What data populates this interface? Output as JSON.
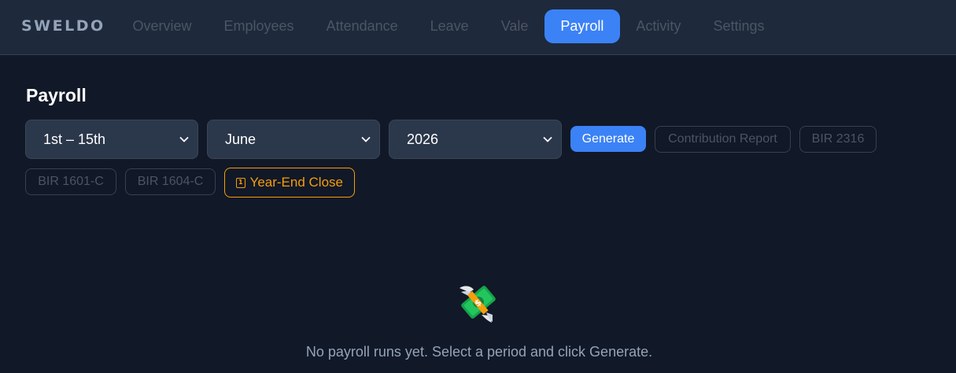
{
  "app": {
    "brand": "SWELDO"
  },
  "nav": {
    "items": [
      {
        "label": "Overview",
        "active": false
      },
      {
        "label": "Employees",
        "active": false
      },
      {
        "label": "Attendance",
        "active": false
      },
      {
        "label": "Leave",
        "active": false
      },
      {
        "label": "Vale",
        "active": false
      },
      {
        "label": "Payroll",
        "active": true
      },
      {
        "label": "Activity",
        "active": false
      },
      {
        "label": "Settings",
        "active": false
      }
    ]
  },
  "page": {
    "title": "Payroll"
  },
  "filters": {
    "period": "1st – 15th",
    "month": "June",
    "year": "2026"
  },
  "actions": {
    "generate": "Generate",
    "contribution_report": "Contribution Report",
    "bir_2316": "BIR 2316",
    "bir_1601c": "BIR 1601-C",
    "bir_1604c": "BIR 1604-C",
    "year_end_close": "Year-End Close",
    "year_end_icon": "calendar-icon"
  },
  "empty_state": {
    "icon": "money-with-wings-icon",
    "message": "No payroll runs yet. Select a period and click Generate."
  },
  "colors": {
    "accent": "#3b82f6",
    "warning": "#f59e0b",
    "background": "#111827",
    "topbar": "#1e293b"
  }
}
